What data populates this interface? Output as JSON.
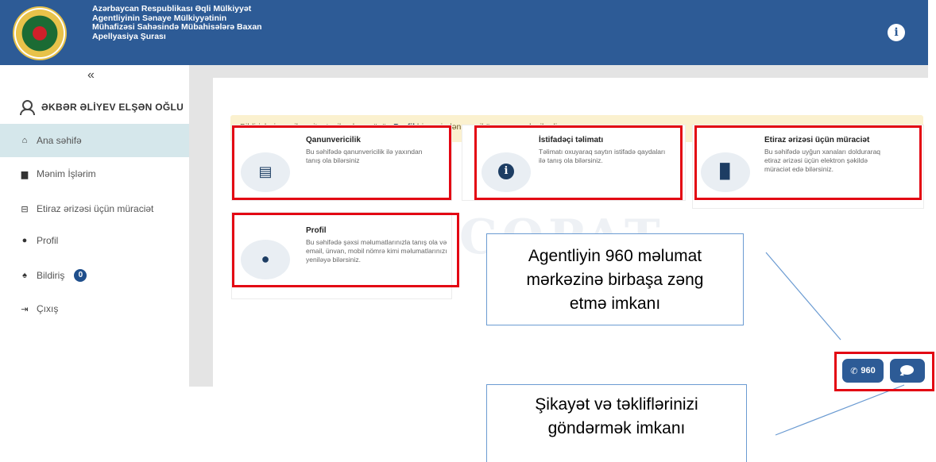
{
  "header": {
    "title_lines": [
      "Azərbaycan Respublikası Əqli Mülkiyyət",
      "Agentliyinin Sənaye Mülkiyyətinin",
      "Mühafizəsi Sahəsində Mübahisələrə Baxan",
      "Apellyasiya Şurası"
    ],
    "info_icon": "i"
  },
  "sidebar": {
    "collapse_icon": "«",
    "user_name": "ƏKBƏR ƏLİYEV ELŞƏN OĞLU",
    "items": [
      {
        "label": "Ana səhifə",
        "icon": "home-icon",
        "glyph": "⌂",
        "active": true
      },
      {
        "label": "Mənim İşlərim",
        "icon": "briefcase-icon",
        "glyph": "▆",
        "active": false
      },
      {
        "label": "Etiraz ərizəsi üçün müraciət",
        "icon": "inbox-icon",
        "glyph": "⊟",
        "active": false
      },
      {
        "label": "Profil",
        "icon": "user-icon",
        "glyph": "●",
        "active": false
      },
      {
        "label": "Bildiriş",
        "icon": "bell-icon",
        "glyph": "♠",
        "active": false,
        "badge": "0"
      },
      {
        "label": "Çıxış",
        "icon": "logout-icon",
        "glyph": "⇥",
        "active": false
      }
    ]
  },
  "alert": {
    "before": "Bildirişləri email vasitəstəsilə almaq üçün ",
    "link": "Profil",
    "after": " hissəsindən email ünvanınızı daxil edin."
  },
  "cards": [
    {
      "title": "Qanunvericilik",
      "desc": "Bu səhifədə qanunvericilik ilə yaxından tanış ola bilərsiniz",
      "icon": "book-icon",
      "glyph": "▤"
    },
    {
      "title": "İstifadəçi təlimatı",
      "desc": "Təlimatı oxuyaraq saytın istifadə qaydaları ilə tanış ola bilərsiniz.",
      "icon": "info-circle-icon",
      "glyph": "i"
    },
    {
      "title": "Etiraz ərizəsi üçün müraciət",
      "desc": "Bu səhifədə uyğun xanaları dolduraraq etiraz ərizəsi üçün elektron şəkildə müraciət edə bilərsiniz.",
      "icon": "file-icon",
      "glyph": "▉"
    },
    {
      "title": "Profil",
      "desc": "Bu səhifədə şəxsi məlumatlarınızla tanış ola və email, ünvan, mobil nömrə kimi məlumatlarınızı yeniləyə bilərsiniz.",
      "icon": "user-icon",
      "glyph": "●"
    }
  ],
  "watermark": "COPAT",
  "callouts": {
    "call_center": "Agentliyin 960 məlumat mərkəzinə birbaşa zəng etmə imkanı",
    "feedback": "Şikayət və təkliflərinizi göndərmək imkanı"
  },
  "floating": {
    "call_label": "960",
    "phone_glyph": "✆"
  },
  "colors": {
    "header_bg": "#2d5b96",
    "active_nav": "#d5e7eb",
    "highlight": "#e30613",
    "callout_border": "#6b9bd2"
  }
}
